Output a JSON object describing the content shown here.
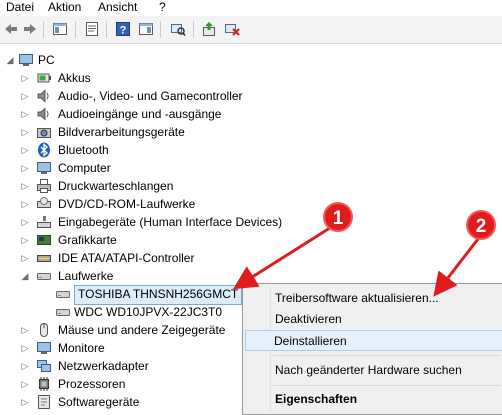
{
  "menu": {
    "file": "Datei",
    "action": "Aktion",
    "view": "Ansicht",
    "help": "?"
  },
  "tree": {
    "root": "PC",
    "items": [
      {
        "label": "Akkus",
        "icon": "battery-icon"
      },
      {
        "label": "Audio-, Video- und Gamecontroller",
        "icon": "speaker-icon"
      },
      {
        "label": "Audioeingänge und -ausgänge",
        "icon": "speaker-icon"
      },
      {
        "label": "Bildverarbeitungsgeräte",
        "icon": "camera-icon"
      },
      {
        "label": "Bluetooth",
        "icon": "bluetooth-icon"
      },
      {
        "label": "Computer",
        "icon": "monitor-icon"
      },
      {
        "label": "Druckwarteschlangen",
        "icon": "printer-icon"
      },
      {
        "label": "DVD/CD-ROM-Laufwerke",
        "icon": "disc-drive-icon"
      },
      {
        "label": "Eingabegeräte (Human Interface Devices)",
        "icon": "hid-icon"
      },
      {
        "label": "Grafikkarte",
        "icon": "graphics-card-icon"
      },
      {
        "label": "IDE ATA/ATAPI-Controller",
        "icon": "controller-icon"
      },
      {
        "label": "Laufwerke",
        "icon": "drive-icon"
      },
      {
        "label": "TOSHIBA THNSNH256GMCT",
        "icon": "drive-icon"
      },
      {
        "label": "WDC WD10JPVX-22JC3T0",
        "icon": "drive-icon"
      },
      {
        "label": "Mäuse und andere Zeigegeräte",
        "icon": "mouse-icon"
      },
      {
        "label": "Monitore",
        "icon": "monitor-icon"
      },
      {
        "label": "Netzwerkadapter",
        "icon": "network-icon"
      },
      {
        "label": "Prozessoren",
        "icon": "processor-icon"
      },
      {
        "label": "Softwaregeräte",
        "icon": "software-device-icon"
      }
    ]
  },
  "context_menu": {
    "update_driver": "Treibersoftware aktualisieren...",
    "disable": "Deaktivieren",
    "uninstall": "Deinstallieren",
    "scan_hardware": "Nach geänderter Hardware suchen",
    "properties": "Eigenschaften"
  },
  "callouts": {
    "first": "1",
    "second": "2"
  },
  "colors": {
    "callout": "#e01c1c",
    "selection": "#dcecfb",
    "menu_bg": "#f0f0f0"
  }
}
